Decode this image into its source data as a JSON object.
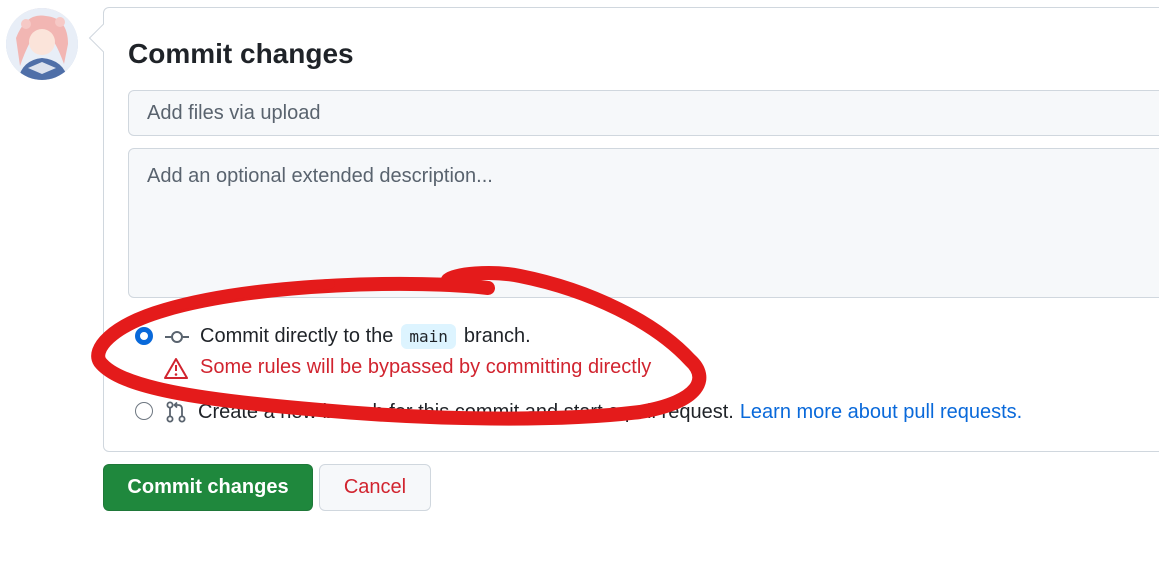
{
  "commit": {
    "title": "Commit changes",
    "summary_placeholder": "Add files via upload",
    "description_placeholder": "Add an optional extended description..."
  },
  "options": {
    "direct": {
      "prefix": "Commit directly to the",
      "branch": "main",
      "suffix": "branch.",
      "selected": true
    },
    "warning": "Some rules will be bypassed by committing directly",
    "new_branch": {
      "text": "Create a new branch for this commit and start a pull request.",
      "link": "Learn more about pull requests.",
      "selected": false
    }
  },
  "buttons": {
    "commit": "Commit changes",
    "cancel": "Cancel"
  },
  "colors": {
    "primary_button": "#1f883d",
    "link": "#0969da",
    "danger": "#d1242f",
    "annotation": "#e41b1b"
  },
  "icons": {
    "commit": "git-commit-icon",
    "pull_request": "git-pull-request-icon",
    "warning": "alert-triangle-icon"
  }
}
